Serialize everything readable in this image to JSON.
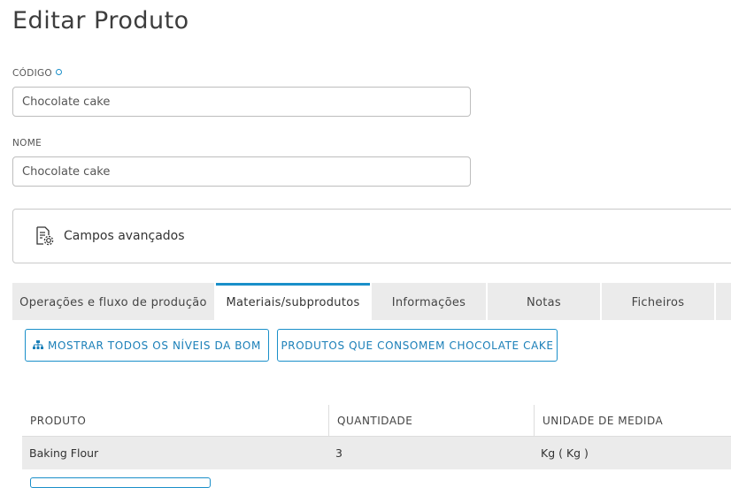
{
  "page": {
    "title": "Editar Produto"
  },
  "form": {
    "code": {
      "label": "CÓDIGO",
      "value": "Chocolate cake"
    },
    "name": {
      "label": "NOME",
      "value": "Chocolate cake"
    }
  },
  "advanced": {
    "label": "Campos avançados",
    "icon": "document-settings-icon"
  },
  "tabs": [
    {
      "label": "Operações e fluxo de produção",
      "active": false
    },
    {
      "label": "Materiais/subprodutos",
      "active": true
    },
    {
      "label": "Informações",
      "active": false
    },
    {
      "label": "Notas",
      "active": false
    },
    {
      "label": "Ficheiros",
      "active": false
    }
  ],
  "actions": {
    "show_bom_levels": "MOSTRAR TODOS OS NÍVEIS DA BOM",
    "consuming_products": "PRODUTOS QUE CONSOMEM CHOCOLATE CAKE"
  },
  "table": {
    "headers": [
      "PRODUTO",
      "QUANTIDADE",
      "UNIDADE DE MEDIDA"
    ],
    "rows": [
      [
        "Baking Flour",
        "3",
        "Kg ( Kg )"
      ]
    ]
  },
  "colors": {
    "accent": "#1a8fc9",
    "tab_bg": "#ebebeb",
    "row_bg": "#ebebeb"
  }
}
